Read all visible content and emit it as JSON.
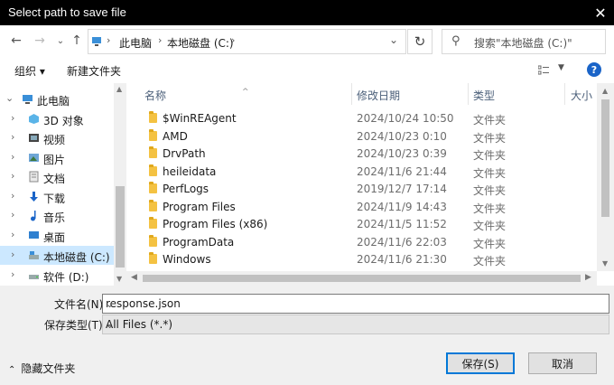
{
  "window": {
    "title": "Select path to save file"
  },
  "address": {
    "crumbs": [
      "此电脑",
      "本地磁盘 (C:)"
    ]
  },
  "search": {
    "placeholder": "搜索\"本地磁盘 (C:)\""
  },
  "toolbar": {
    "organize": "组织 ▾",
    "new_folder": "新建文件夹"
  },
  "navpane": {
    "items": [
      {
        "label": "此电脑",
        "icon": "computer-icon",
        "expanded": true
      },
      {
        "label": "3D 对象",
        "icon": "cube-icon"
      },
      {
        "label": "视频",
        "icon": "video-icon"
      },
      {
        "label": "图片",
        "icon": "picture-icon"
      },
      {
        "label": "文档",
        "icon": "document-icon"
      },
      {
        "label": "下载",
        "icon": "download-icon"
      },
      {
        "label": "音乐",
        "icon": "music-icon"
      },
      {
        "label": "桌面",
        "icon": "desktop-icon"
      },
      {
        "label": "本地磁盘 (C:)",
        "icon": "drive-icon",
        "selected": true
      },
      {
        "label": "软件 (D:)",
        "icon": "drive-icon"
      }
    ]
  },
  "columns": {
    "name": "名称",
    "modified": "修改日期",
    "type": "类型",
    "size": "大小"
  },
  "files": [
    {
      "name": "$WinREAgent",
      "modified": "2024/10/24 10:50",
      "type": "文件夹"
    },
    {
      "name": "AMD",
      "modified": "2024/10/23 0:10",
      "type": "文件夹"
    },
    {
      "name": "DrvPath",
      "modified": "2024/10/23 0:39",
      "type": "文件夹"
    },
    {
      "name": "heileidata",
      "modified": "2024/11/6 21:44",
      "type": "文件夹"
    },
    {
      "name": "PerfLogs",
      "modified": "2019/12/7 17:14",
      "type": "文件夹"
    },
    {
      "name": "Program Files",
      "modified": "2024/11/9 14:43",
      "type": "文件夹"
    },
    {
      "name": "Program Files (x86)",
      "modified": "2024/11/5 11:52",
      "type": "文件夹"
    },
    {
      "name": "ProgramData",
      "modified": "2024/11/6 22:03",
      "type": "文件夹"
    },
    {
      "name": "Windows",
      "modified": "2024/11/6 21:30",
      "type": "文件夹"
    }
  ],
  "form": {
    "filename_label": "文件名(N):",
    "filename_value": "response.json",
    "filetype_label": "保存类型(T):",
    "filetype_value": "All Files (*.*)"
  },
  "footer": {
    "hide_folders": "隐藏文件夹",
    "save": "保存(S)",
    "cancel": "取消"
  },
  "colors": {
    "accent": "#0078d7",
    "selection": "#cce8ff",
    "folder": "#f4c242"
  }
}
